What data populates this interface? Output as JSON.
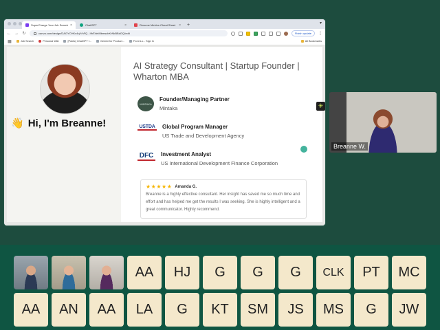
{
  "browser": {
    "tabs": [
      {
        "label": "SuperCharge Your Job Search",
        "active": true,
        "favicon": "canva-icon"
      },
      {
        "label": "ChatGPT",
        "active": false,
        "favicon": "chatgpt-icon"
      },
      {
        "label": "Resume Metrics Cheat Sheet",
        "active": false,
        "favicon": "doc-icon"
      }
    ],
    "url": "canva.com/design/DAGYCHKx4qY/hFQ...IfhSVeMIbmszbKrNkBBdGQ/edit",
    "finish_update_label": "Finish update",
    "bookmarks": [
      "Job Search",
      "Personal Wiki",
      "[Public] ChatGPT f...",
      "Gemini for Product...",
      "Front Lo... Sign In"
    ],
    "all_bookmarks_label": "All Bookmarks"
  },
  "profile": {
    "headline": "AI Strategy Consultant | Startup Founder | Wharton MBA",
    "greeting": "Hi, I'm Breanne!",
    "greeting_emoji": "👋",
    "experience": [
      {
        "title": "Founder/Managing Partner",
        "org": "Mintaka",
        "logo_text": "MINTAKA"
      },
      {
        "title": "Global Program Manager",
        "org": "US Trade and Development Agency",
        "logo_text": "USTDA"
      },
      {
        "title": "Investment Analyst",
        "org": "US International Development Finance Corporation",
        "logo_text": "DFC"
      }
    ],
    "review": {
      "stars": "★★★★★",
      "reviewer": "Amanda G.",
      "text": "Breanne is a highly effective consultant. Her insight has saved me so much time and effort and has helped me get the results I was seeking. She is highly intelligent and a great communicator. Highly recommend."
    }
  },
  "zoom": {
    "reaction_emoji": "✳",
    "self_view_name": "Breanne W.",
    "participants_row1": [
      "AA",
      "HJ",
      "G",
      "G",
      "G",
      "CLK",
      "PT",
      "MC"
    ],
    "participants_row2": [
      "AA",
      "AN",
      "AA",
      "LA",
      "G",
      "KT",
      "SM",
      "JS",
      "MS",
      "G",
      "JW"
    ]
  }
}
